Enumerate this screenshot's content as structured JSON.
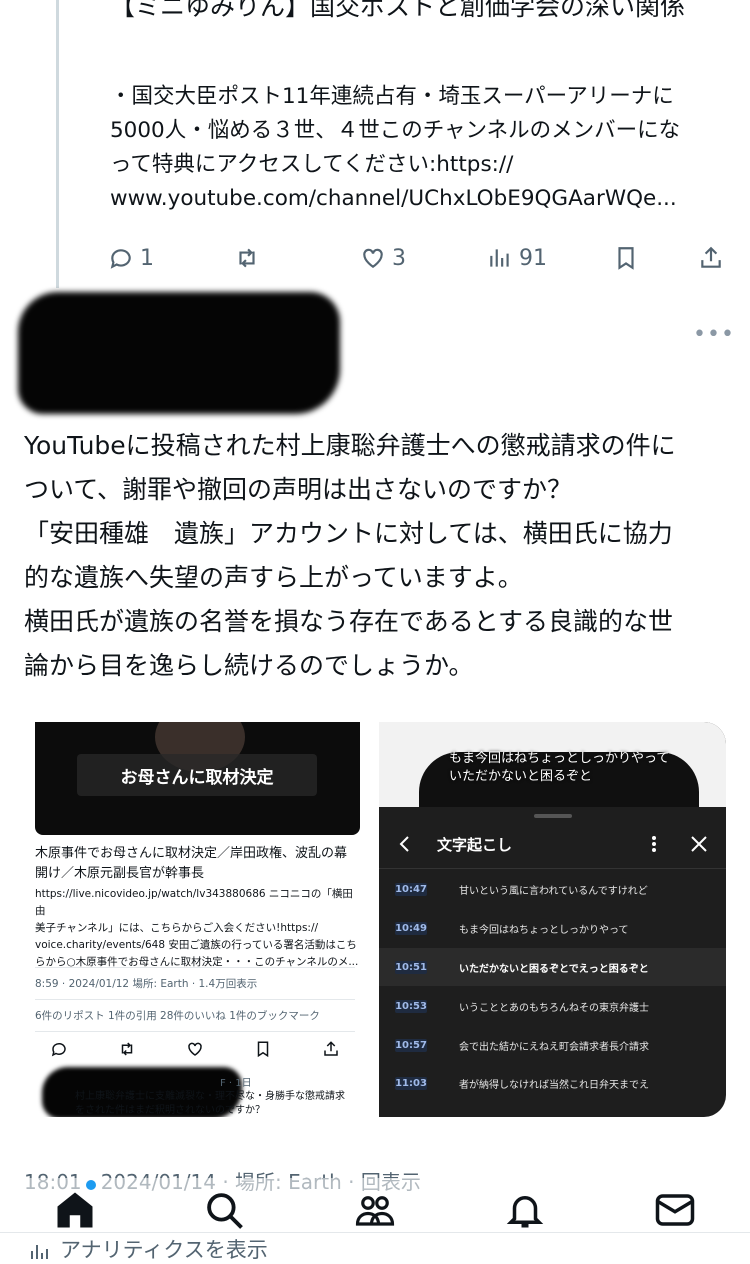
{
  "quoted_post": {
    "title": "【ミニゆみりん】国交ポストと創価学会の深い関係",
    "body_lines": [
      "・国交大臣ポスト11年連続占有・埼玉スーパーアリーナに",
      "5000人・悩める３世、４世このチャンネルのメンバーにな",
      "って特典にアクセスしてください:https://",
      "www.youtube.com/channel/UChxLObE9QGAarWQe..."
    ],
    "actions": {
      "reply_count": "1",
      "like_count": "3",
      "view_count": "91"
    }
  },
  "post": {
    "more": "•••",
    "text_lines": [
      "YouTubeに投稿された村上康聡弁護士への懲戒請求の件に",
      "ついて、謝罪や撤回の声明は出さないのですか？",
      "「安田種雄　遺族」アカウントに対しては、横田氏に協力",
      "的な遺族へ失望の声すら上がっていますよ。",
      "横田氏が遺族の名誉を損なう存在であるとする良識的な世",
      "論から目を逸らし続けるのでしょうか。"
    ],
    "timestamp": "18:01 · 2024/01/14 · 場所: Earth · 回表示",
    "analytics_label": "アナリティクスを表示"
  },
  "image_left": {
    "video_caption": "お母さんに取材決定",
    "title_lines": [
      "木原事件でお母さんに取材決定／岸田政権、波乱の幕",
      "開け／木原元副長官が幹事長"
    ],
    "desc_lines": [
      "https://live.nicovideo.jp/watch/lv343880686 ニコニコの「横田由",
      "美子チャンネル」には、こちらからご入会ください!https://",
      "voice.charity/events/648 安田ご遺族の行っている署名活動はこち",
      "らから○木原事件でお母さんに取材決定・・・このチャンネルのメ..."
    ],
    "meta": "8:59 · 2024/01/12 場所: Earth · 1.4万回表示",
    "stats": "6件のリポスト 1件の引用 28件のいいね 1件のブックマーク",
    "reply_meta": "F · 1日",
    "reply_lines": [
      "村上康聡弁護士に支離滅裂な・理不尽な・身勝手な懲戒請求",
      "をされた件はまだ釈明されないのですか？"
    ]
  },
  "image_right": {
    "subtitle_lines": [
      "もま今回はねちょっとしっかりやって",
      "いただかないと困るぞと"
    ],
    "panel_title": "文字起こし",
    "rows": [
      {
        "time": "10:47",
        "text": "甘いという風に言われているんですけれど"
      },
      {
        "time": "10:49",
        "text": "もま今回はねちょっとしっかりやって"
      },
      {
        "time": "10:51",
        "text": "いただかないと困るぞとでえっと困るぞと"
      },
      {
        "time": "10:53",
        "text": "いうこととあのもちろんねその東京弁護士"
      },
      {
        "time": "10:57",
        "text": "会で出た結かにえねえ町会請求者長介請求"
      },
      {
        "time": "11:03",
        "text": "者が納得しなければ当然これ日弁天までえ"
      }
    ]
  },
  "colors": {
    "accent": "#1d9bf0",
    "text": "#0f1419",
    "muted": "#536471",
    "dark_panel": "#1e1e1e"
  },
  "nav": {
    "items": [
      "home-icon",
      "search-icon",
      "communities-icon",
      "notifications-icon",
      "messages-icon"
    ]
  }
}
